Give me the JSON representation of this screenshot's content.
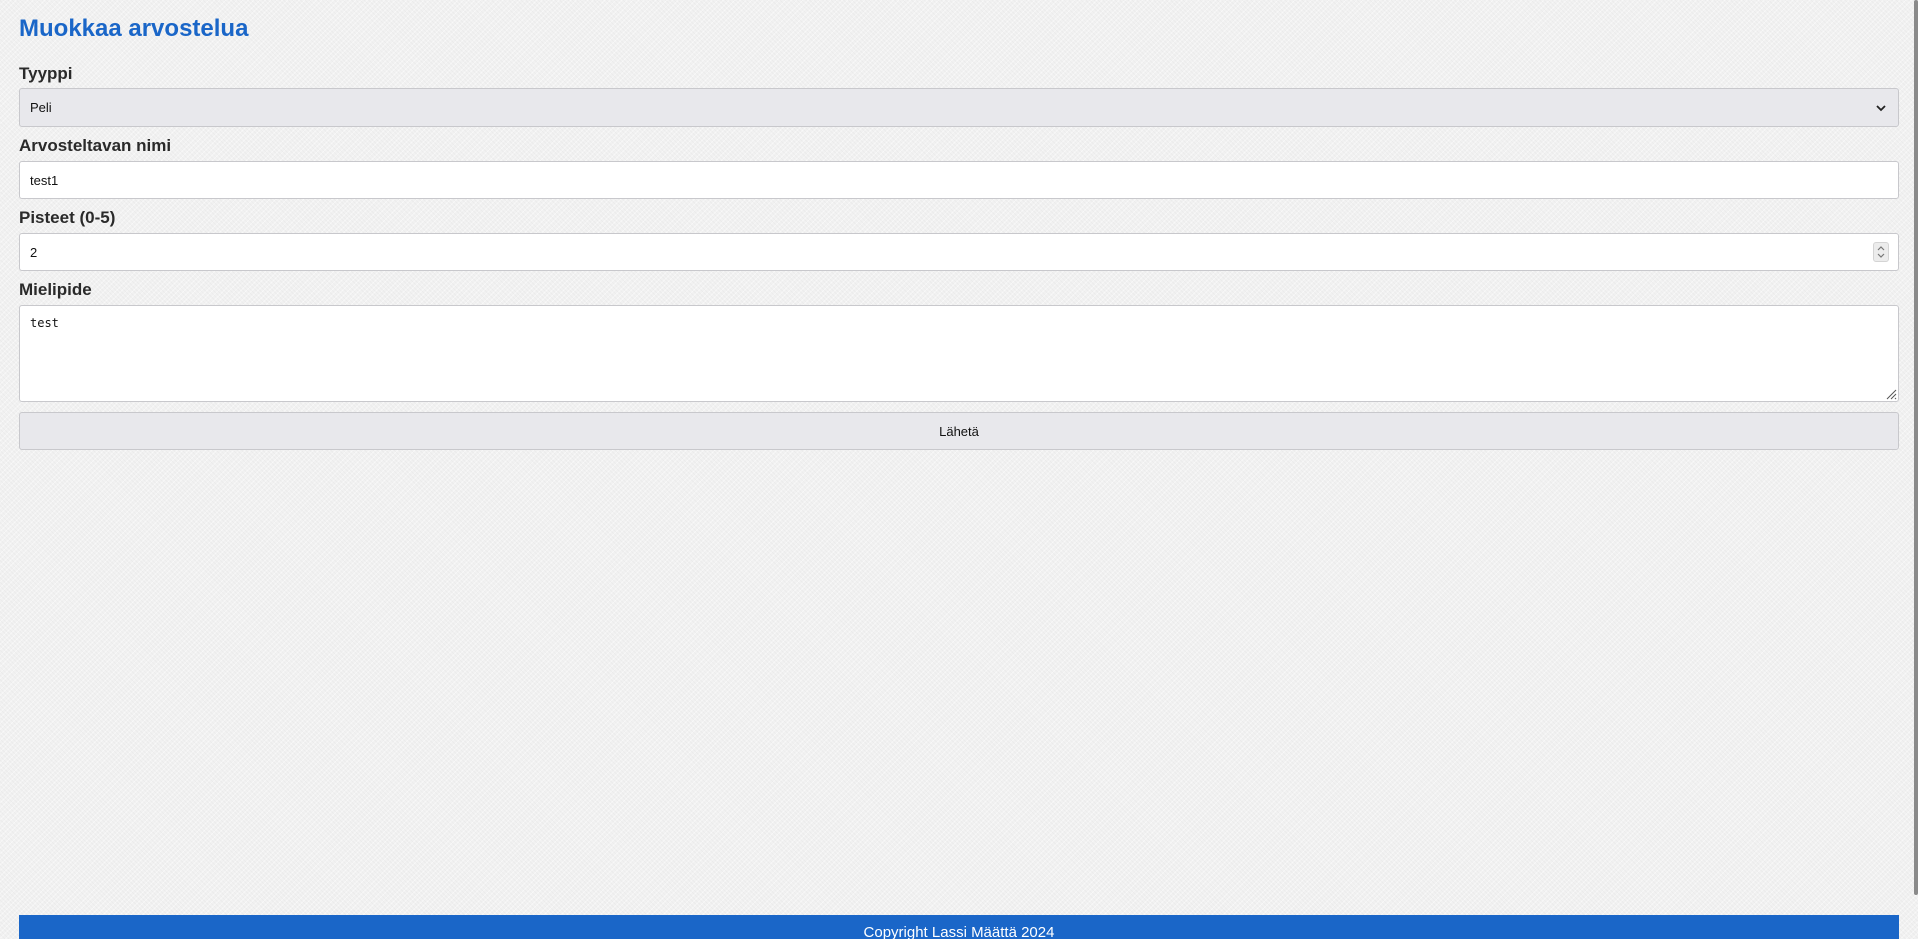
{
  "page": {
    "title": "Muokkaa arvostelua"
  },
  "form": {
    "type": {
      "label": "Tyyppi",
      "value": "Peli"
    },
    "name": {
      "label": "Arvosteltavan nimi",
      "value": "test1"
    },
    "score": {
      "label": "Pisteet (0-5)",
      "value": "2"
    },
    "opinion": {
      "label": "Mielipide",
      "value": "test"
    },
    "submit_label": "Lähetä"
  },
  "footer": {
    "text": "Copyright Lassi Määttä 2024"
  },
  "colors": {
    "accent": "#1a66c8",
    "control_bg": "#e8e8ec"
  }
}
